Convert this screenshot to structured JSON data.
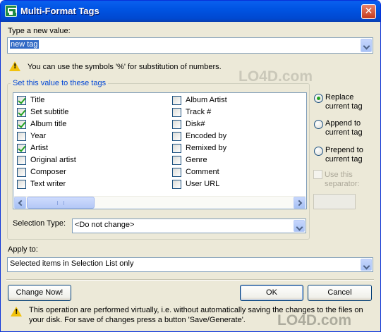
{
  "window": {
    "title": "Multi-Format Tags",
    "close_glyph": "✕"
  },
  "new_value": {
    "label": "Type a new value:",
    "value": "new tag",
    "hint": "You can use the symbols '%' for substitution of numbers."
  },
  "tags_group": {
    "label": "Set this value to these tags",
    "left_column": [
      {
        "label": "Title",
        "checked": true
      },
      {
        "label": "Set subtitle",
        "checked": true
      },
      {
        "label": "Album title",
        "checked": true
      },
      {
        "label": "Year",
        "checked": false
      },
      {
        "label": "Artist",
        "checked": true
      },
      {
        "label": "Original artist",
        "checked": false
      },
      {
        "label": "Composer",
        "checked": false
      },
      {
        "label": "Text writer",
        "checked": false
      }
    ],
    "right_column": [
      {
        "label": "Album Artist",
        "checked": false
      },
      {
        "label": "Track #",
        "checked": false
      },
      {
        "label": "Disk#",
        "checked": false
      },
      {
        "label": "Encoded by",
        "checked": false
      },
      {
        "label": "Remixed by",
        "checked": false
      },
      {
        "label": "Genre",
        "checked": false
      },
      {
        "label": "Comment",
        "checked": false
      },
      {
        "label": "User URL",
        "checked": false
      }
    ],
    "scroll_grip": "|||"
  },
  "mode_options": [
    {
      "line1": "Replace",
      "line2": "current tag",
      "selected": true
    },
    {
      "line1": "Append to",
      "line2": "current tag",
      "selected": false
    },
    {
      "line1": "Prepend to",
      "line2": "current tag",
      "selected": false
    }
  ],
  "separator": {
    "line1": "Use this",
    "line2": "separator:",
    "enabled": false
  },
  "selection_type": {
    "label": "Selection Type:",
    "value": "<Do not change>"
  },
  "apply_to": {
    "label": "Apply to:",
    "value": "Selected items in Selection List only"
  },
  "buttons": {
    "change_now": "Change Now!",
    "ok": "OK",
    "cancel": "Cancel"
  },
  "footer_note": "This operation are performed virtually, i.e. without automatically saving the changes to the files on your disk. For save of changes press a button 'Save/Generate'.",
  "watermark": "LO4D.com"
}
